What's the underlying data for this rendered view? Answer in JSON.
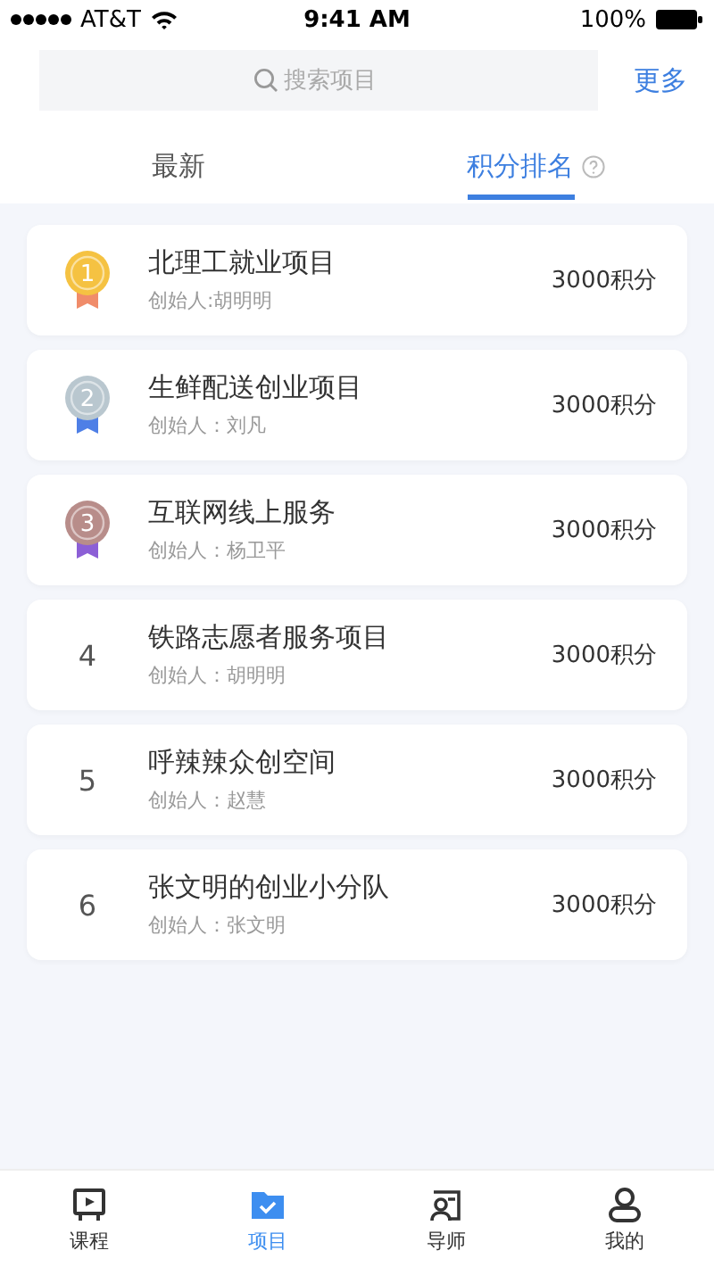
{
  "status_bar": {
    "carrier": "AT&T",
    "time": "9:41 AM",
    "battery": "100%"
  },
  "search": {
    "placeholder": "搜索项目"
  },
  "more_link": "更多",
  "tabs": [
    {
      "label": "最新",
      "selected": false,
      "help": false
    },
    {
      "label": "积分排名",
      "selected": true,
      "help": true
    }
  ],
  "projects": [
    {
      "rank": "1",
      "kind": "medal",
      "color": "#f5c242",
      "title": "北理工就业项目",
      "founder": "创始人:胡明明",
      "points": "3000积分"
    },
    {
      "rank": "2",
      "kind": "medal",
      "color": "#b9c7cf",
      "title": "生鲜配送创业项目",
      "founder": "创始人：刘凡",
      "points": "3000积分"
    },
    {
      "rank": "3",
      "kind": "medal",
      "color": "#b88d8a",
      "title": "互联网线上服务",
      "founder": "创始人：杨卫平",
      "points": "3000积分"
    },
    {
      "rank": "4",
      "kind": "number",
      "title": "铁路志愿者服务项目",
      "founder": "创始人：胡明明",
      "points": "3000积分"
    },
    {
      "rank": "5",
      "kind": "number",
      "title": "呼辣辣众创空间",
      "founder": "创始人：赵慧",
      "points": "3000积分"
    },
    {
      "rank": "6",
      "kind": "number",
      "title": "张文明的创业小分队",
      "founder": "创始人：张文明",
      "points": "3000积分"
    }
  ],
  "bottom_nav": [
    {
      "label": "课程",
      "kind": "course",
      "selected": false
    },
    {
      "label": "项目",
      "kind": "project",
      "selected": true
    },
    {
      "label": "导师",
      "kind": "mentor",
      "selected": false
    },
    {
      "label": "我的",
      "kind": "me",
      "selected": false
    }
  ]
}
